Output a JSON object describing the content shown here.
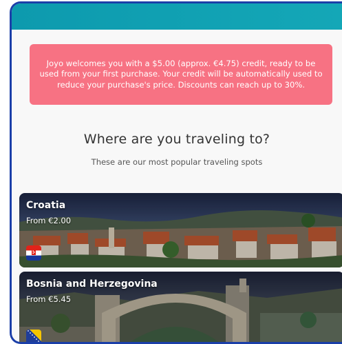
{
  "banner": {
    "text": "Joyo welcomes you with a $5.00 (approx. €4.75) credit, ready to be used from your first purchase. Your credit will be automatically used to reduce your purchase's price. Discounts can reach up to 30%."
  },
  "section": {
    "title": "Where are you traveling to?",
    "subtitle": "These are our most popular traveling spots"
  },
  "destinations": [
    {
      "name": "Croatia",
      "price": "From €2.00",
      "flag": "croatia-flag-icon"
    },
    {
      "name": "Bosnia and Herzegovina",
      "price": "From €5.45",
      "flag": "bosnia-flag-icon"
    }
  ],
  "colors": {
    "header": "#14a7b7",
    "banner": "#f77283",
    "frame": "#1b3fa8"
  }
}
